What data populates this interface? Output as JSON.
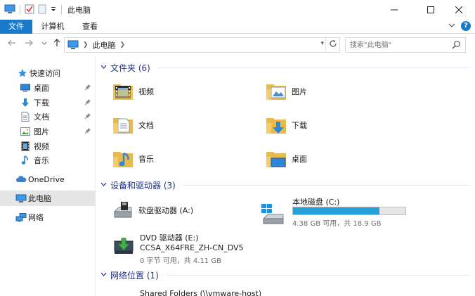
{
  "window": {
    "title": "此电脑",
    "accent": "#1979ca"
  },
  "ribbon": {
    "tabs": [
      "文件",
      "计算机",
      "查看"
    ]
  },
  "address": {
    "crumb": "此电脑",
    "search_placeholder": "搜索\"此电脑\""
  },
  "sidebar": {
    "quick_access": "快速访问",
    "items": [
      {
        "label": "桌面",
        "icon": "desktop-icon",
        "pinned": true
      },
      {
        "label": "下载",
        "icon": "download-icon",
        "pinned": true
      },
      {
        "label": "文档",
        "icon": "document-icon",
        "pinned": true
      },
      {
        "label": "图片",
        "icon": "picture-icon",
        "pinned": true
      },
      {
        "label": "视频",
        "icon": "video-icon",
        "pinned": false
      },
      {
        "label": "音乐",
        "icon": "music-icon",
        "pinned": false
      }
    ],
    "onedrive": "OneDrive",
    "this_pc": "此电脑",
    "network": "网络"
  },
  "content": {
    "folders_header": "文件夹 (6)",
    "folders": [
      {
        "name": "视频",
        "icon": "video-folder-icon"
      },
      {
        "name": "图片",
        "icon": "picture-folder-icon"
      },
      {
        "name": "文档",
        "icon": "document-folder-icon"
      },
      {
        "name": "下载",
        "icon": "download-folder-icon"
      },
      {
        "name": "音乐",
        "icon": "music-folder-icon"
      },
      {
        "name": "桌面",
        "icon": "desktop-folder-icon"
      }
    ],
    "devices_header": "设备和驱动器 (3)",
    "floppy": {
      "name": "软盘驱动器 (A:)"
    },
    "disk_c": {
      "name": "本地磁盘 (C:)",
      "free_text": "4.38 GB 可用，共 18.9 GB",
      "used_fraction": 0.768
    },
    "dvd": {
      "name": "DVD 驱动器 (E:)",
      "volume": "CCSA_X64FRE_ZH-CN_DV5",
      "free_text": "0 字节 可用，共 4.11 GB"
    },
    "network_header": "网络位置 (1)",
    "network_item": "Shared Folders (\\\\vmware-host)"
  }
}
